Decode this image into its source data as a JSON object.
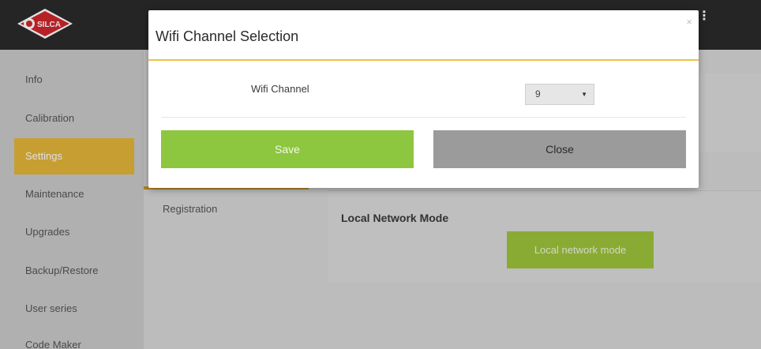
{
  "brand": {
    "logo_text": "SILCA"
  },
  "sidebar": {
    "items": [
      {
        "label": "Info"
      },
      {
        "label": "Calibration"
      },
      {
        "label": "Settings",
        "active": true
      },
      {
        "label": "Maintenance"
      },
      {
        "label": "Upgrades"
      },
      {
        "label": "Backup/Restore"
      },
      {
        "label": "User series"
      },
      {
        "label": "Code Maker"
      }
    ]
  },
  "subnav": {
    "registration_label": "Registration"
  },
  "panel": {
    "title": "Local Network Mode",
    "button_label": "Local network mode"
  },
  "modal": {
    "title": "Wifi Channel Selection",
    "close_glyph": "×",
    "field_label": "Wifi Channel",
    "select_value": "9",
    "save_label": "Save",
    "close_label": "Close"
  },
  "colors": {
    "accent": "#e3b43a",
    "save_green": "#8dc63f",
    "close_grey": "#9b9b9b",
    "topbar": "#2b2b2b"
  },
  "icons": {
    "logo": "silca-logo-icon",
    "menu": "kebab-menu-icon",
    "caret": "caret-down-icon"
  }
}
